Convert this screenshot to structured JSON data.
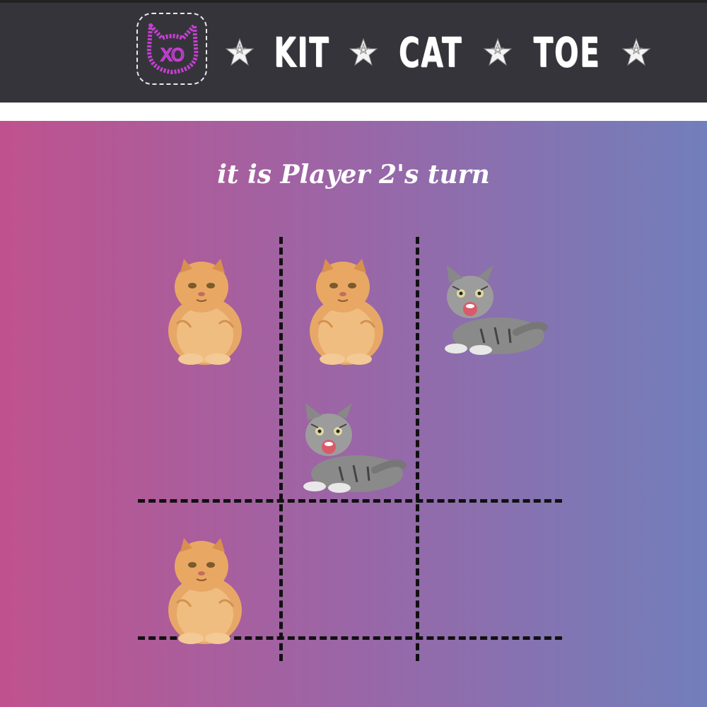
{
  "header": {
    "title_words": [
      "KIT",
      "CAT",
      "TOE"
    ],
    "logo_text": "XO"
  },
  "status": {
    "turn_text": "it is Player 2's turn"
  },
  "board": {
    "cells": [
      "persian",
      "persian",
      "tabby",
      "",
      "tabby",
      "",
      "persian",
      "",
      ""
    ]
  },
  "colors": {
    "header_bg": "#36343b",
    "gradient_left": "#bf528e",
    "gradient_right": "#717fbb",
    "logo_pink": "#c53fd2"
  },
  "icons": {
    "logo": "cat-xo-icon",
    "separator": "pentagram-star-icon"
  }
}
